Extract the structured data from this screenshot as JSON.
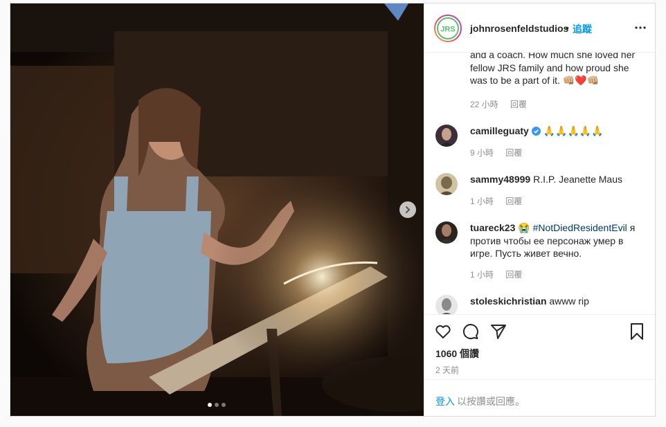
{
  "post": {
    "username": "johnrosenfeldstudios",
    "separator": "•",
    "follow_label": "追蹤",
    "logo_text": "JRS",
    "caption_fragment": "and a coach. How much she loved her fellow JRS family and how proud she was to be a part of it. 👊🏼❤️👊🏼",
    "caption_meta": {
      "time": "22 小時",
      "reply": "回覆"
    },
    "likes": "1060 個讚",
    "posted": "2 天前",
    "carousel": {
      "count": 3,
      "active": 0
    }
  },
  "comments": [
    {
      "user": "camilleguaty",
      "verified": true,
      "text": "🙏🙏🙏🙏🙏",
      "time": "9 小時",
      "reply": "回覆"
    },
    {
      "user": "sammy48999",
      "verified": false,
      "text": "R.I.P. Jeanette Maus",
      "time": "1 小時",
      "reply": "回覆"
    },
    {
      "user": "tuareck23",
      "verified": false,
      "emoji": "😭",
      "hashtag": "#NotDiedResidentEvil",
      "text": "я против чтобы ее персонаж умер в игре. Пусть живет вечно.",
      "time": "1 小時",
      "reply": "回覆"
    },
    {
      "user": "stoleskichristian",
      "verified": false,
      "text": "awww rip"
    }
  ],
  "login_prompt": {
    "link": "登入",
    "rest": "以按讚或回應。"
  },
  "icons": {
    "like": "heart-icon",
    "comment": "comment-icon",
    "share": "paper-plane-icon",
    "save": "bookmark-icon",
    "more": "more-icon",
    "next": "chevron-right-icon",
    "verified": "verified-badge-icon"
  },
  "colors": {
    "accent": "#0095f6",
    "link": "#00376b",
    "muted": "#8e8e8e",
    "text": "#262626",
    "verified": "#3897f0"
  }
}
